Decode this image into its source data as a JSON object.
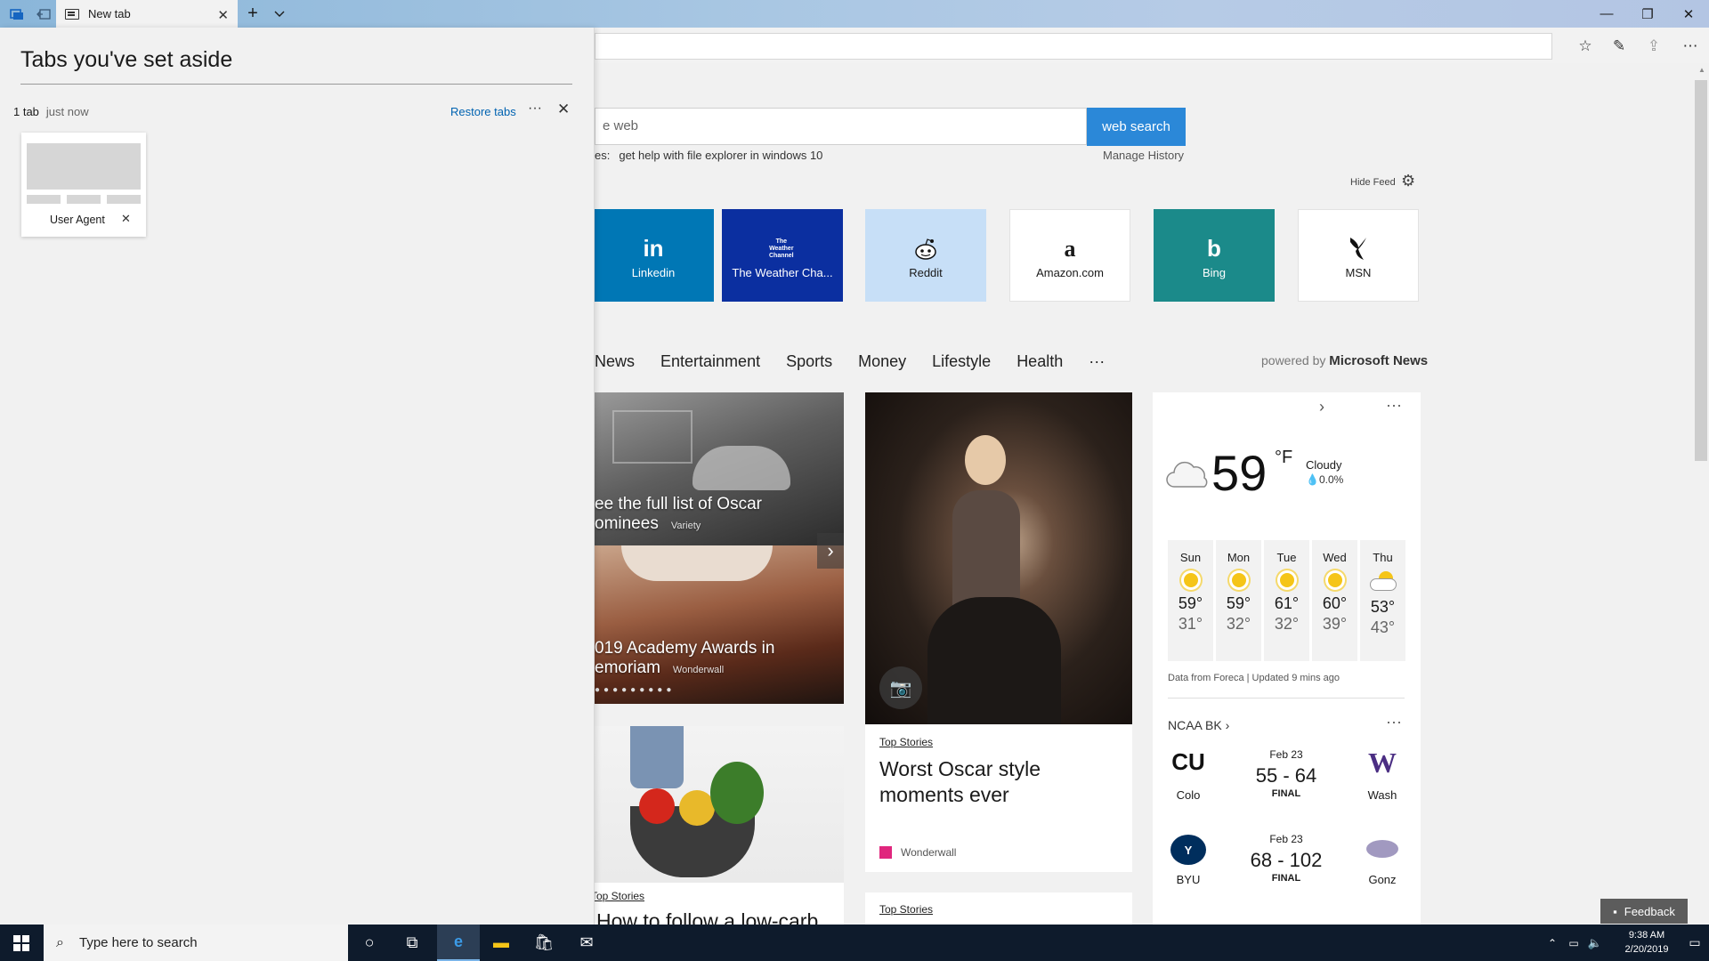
{
  "browser": {
    "tab_title": "New tab"
  },
  "search": {
    "placeholder": "e web",
    "button": "web search",
    "trending_prefix": "es:",
    "trending_item": "get help with file explorer in windows 10",
    "manage_history": "Manage History",
    "hide_feed": "Hide Feed"
  },
  "tiles": [
    {
      "label": "Linkedin",
      "icon": "in",
      "bg": "#0077b5",
      "fg": "#ffffff"
    },
    {
      "label": "The Weather Cha...",
      "icon": "The Weather Channel",
      "bg": "#0b2fa0",
      "fg": "#ffffff"
    },
    {
      "label": "Reddit",
      "icon": "reddit-icon",
      "bg": "#c7dff7",
      "fg": "#1a1a1a"
    },
    {
      "label": "Amazon.com",
      "icon": "a",
      "bg": "#ffffff",
      "fg": "#1a1a1a"
    },
    {
      "label": "Bing",
      "icon": "b",
      "bg": "#1b8a8a",
      "fg": "#ffffff"
    },
    {
      "label": "MSN",
      "icon": "msn-butterfly-icon",
      "bg": "#ffffff",
      "fg": "#1a1a1a"
    }
  ],
  "news_nav": [
    "News",
    "Entertainment",
    "Sports",
    "Money",
    "Lifestyle",
    "Health",
    "···"
  ],
  "powered_by": {
    "prefix": "powered by",
    "brand": "Microsoft News"
  },
  "cards": {
    "slideshow_1": {
      "title_l1": "ee the full list of Oscar",
      "title_l2": "ominees",
      "source": "Variety"
    },
    "slideshow_2": {
      "title_l1": "019 Academy Awards in",
      "title_l2": "emoriam",
      "source": "Wonderwall"
    },
    "feature": {
      "tag": "Top Stories",
      "title": "Worst Oscar style moments ever",
      "source": "Wonderwall"
    },
    "lower_left": {
      "tag": "Top Stories",
      "title": "How to follow a low-carb"
    },
    "lower_mid": {
      "tag": "Top Stories"
    }
  },
  "weather": {
    "temp": "59",
    "unit": "°F",
    "condition": "Cloudy",
    "precip": "0.0%",
    "forecast": [
      {
        "day": "Sun",
        "hi": "59°",
        "lo": "31°",
        "icon": "sunny-icon"
      },
      {
        "day": "Mon",
        "hi": "59°",
        "lo": "32°",
        "icon": "sunny-icon"
      },
      {
        "day": "Tue",
        "hi": "61°",
        "lo": "32°",
        "icon": "sunny-icon"
      },
      {
        "day": "Wed",
        "hi": "60°",
        "lo": "39°",
        "icon": "sunny-icon"
      },
      {
        "day": "Thu",
        "hi": "53°",
        "lo": "43°",
        "icon": "partly-cloudy-icon"
      }
    ],
    "footer": "Data from Foreca | Updated 9 mins ago"
  },
  "scores": {
    "header": "NCAA BK",
    "games": [
      {
        "date": "Feb 23",
        "score": "55 - 64",
        "status": "FINAL",
        "home": "Colo",
        "away": "Wash"
      },
      {
        "date": "Feb 23",
        "score": "68 - 102",
        "status": "FINAL",
        "home": "BYU",
        "away": "Gonz"
      }
    ]
  },
  "aside": {
    "title": "Tabs you've set aside",
    "count": "1 tab",
    "when": "just now",
    "restore": "Restore tabs",
    "thumb_label": "User Agent"
  },
  "feedback": "Feedback",
  "taskbar": {
    "search_placeholder": "Type here to search",
    "time": "9:38 AM",
    "date": "2/20/2019"
  }
}
